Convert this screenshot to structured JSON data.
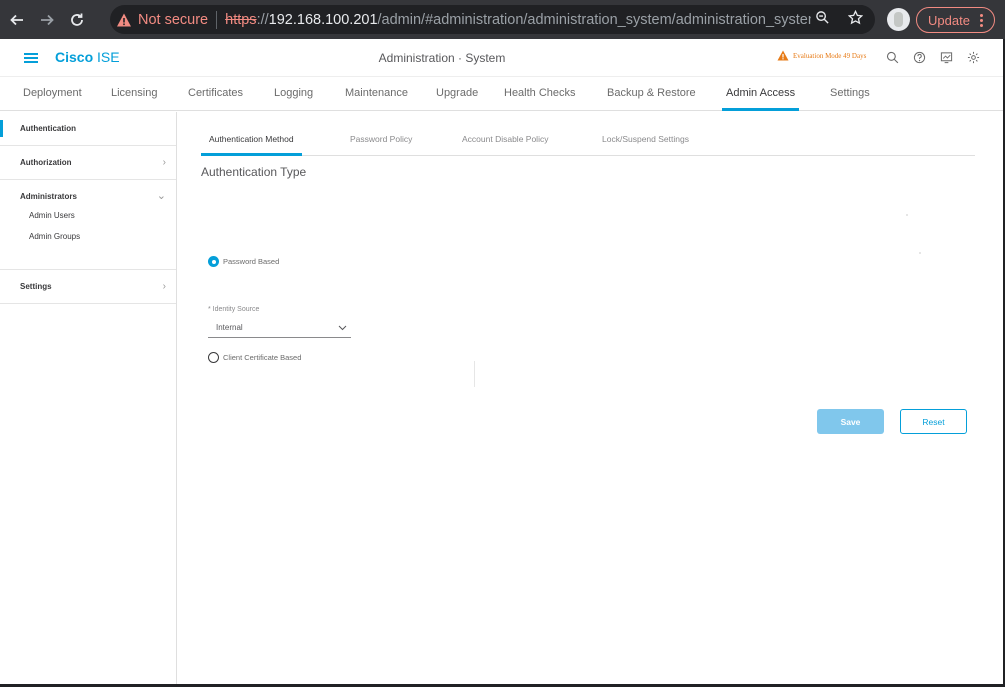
{
  "browser": {
    "not_secure": "Not secure",
    "url_scheme": "https",
    "url_sep": "://",
    "url_host": "192.168.100.201",
    "url_path": "/admin/#administration/administration_system/administration_system_...",
    "update_label": "Update"
  },
  "header": {
    "brand_bold": "Cisco",
    "brand_light": "ISE",
    "title": "Administration · System",
    "eval_text": "Evaluation Mode 49 Days"
  },
  "top_tabs": [
    {
      "label": "Deployment"
    },
    {
      "label": "Licensing"
    },
    {
      "label": "Certificates"
    },
    {
      "label": "Logging"
    },
    {
      "label": "Maintenance"
    },
    {
      "label": "Upgrade"
    },
    {
      "label": "Health Checks"
    },
    {
      "label": "Backup & Restore"
    },
    {
      "label": "Admin Access"
    },
    {
      "label": "Settings"
    }
  ],
  "sidebar": {
    "authentication": "Authentication",
    "authorization": "Authorization",
    "administrators": "Administrators",
    "admin_users": "Admin Users",
    "admin_groups": "Admin Groups",
    "settings": "Settings"
  },
  "sub_tabs": [
    {
      "label": "Authentication Method"
    },
    {
      "label": "Password Policy"
    },
    {
      "label": "Account Disable Policy"
    },
    {
      "label": "Lock/Suspend Settings"
    }
  ],
  "form": {
    "section_title": "Authentication Type",
    "password_based": "Password Based",
    "identity_source_label": "* Identity Source",
    "identity_source_value": "Internal",
    "client_cert_based": "Client Certificate Based",
    "save_label": "Save",
    "reset_label": "Reset"
  },
  "colors": {
    "accent": "#049fd9",
    "warning": "#e77b17",
    "insecure": "#f28b82"
  }
}
